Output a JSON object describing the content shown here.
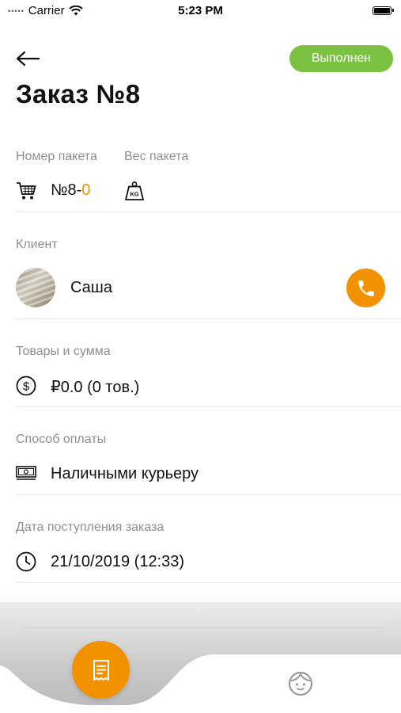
{
  "status_bar": {
    "carrier": "Carrier",
    "time": "5:23 PM"
  },
  "header": {
    "order_status": "Выполнен",
    "title": "Заказ №8"
  },
  "package": {
    "number_label": "Номер пакета",
    "weight_label": "Вес пакета",
    "number_prefix": "№8-",
    "number_suffix": "0"
  },
  "client": {
    "label": "Клиент",
    "name": "Саша"
  },
  "goods": {
    "label": "Товары и сумма",
    "value": "₽0.0 (0 тов.)"
  },
  "payment": {
    "label": "Способ оплаты",
    "value": "Наличными курьеру"
  },
  "order_date": {
    "label": "Дата поступления заказа",
    "value": "21/10/2019 (12:33)"
  },
  "colors": {
    "accent": "#f39200",
    "status_done": "#7bc243",
    "label_gray": "#8e8e93"
  },
  "icons": [
    "back-arrow-icon",
    "cart-icon",
    "weight-kg-icon",
    "phone-icon",
    "dollar-coin-icon",
    "cash-icon",
    "clock-icon",
    "receipt-icon",
    "child-face-icon"
  ]
}
